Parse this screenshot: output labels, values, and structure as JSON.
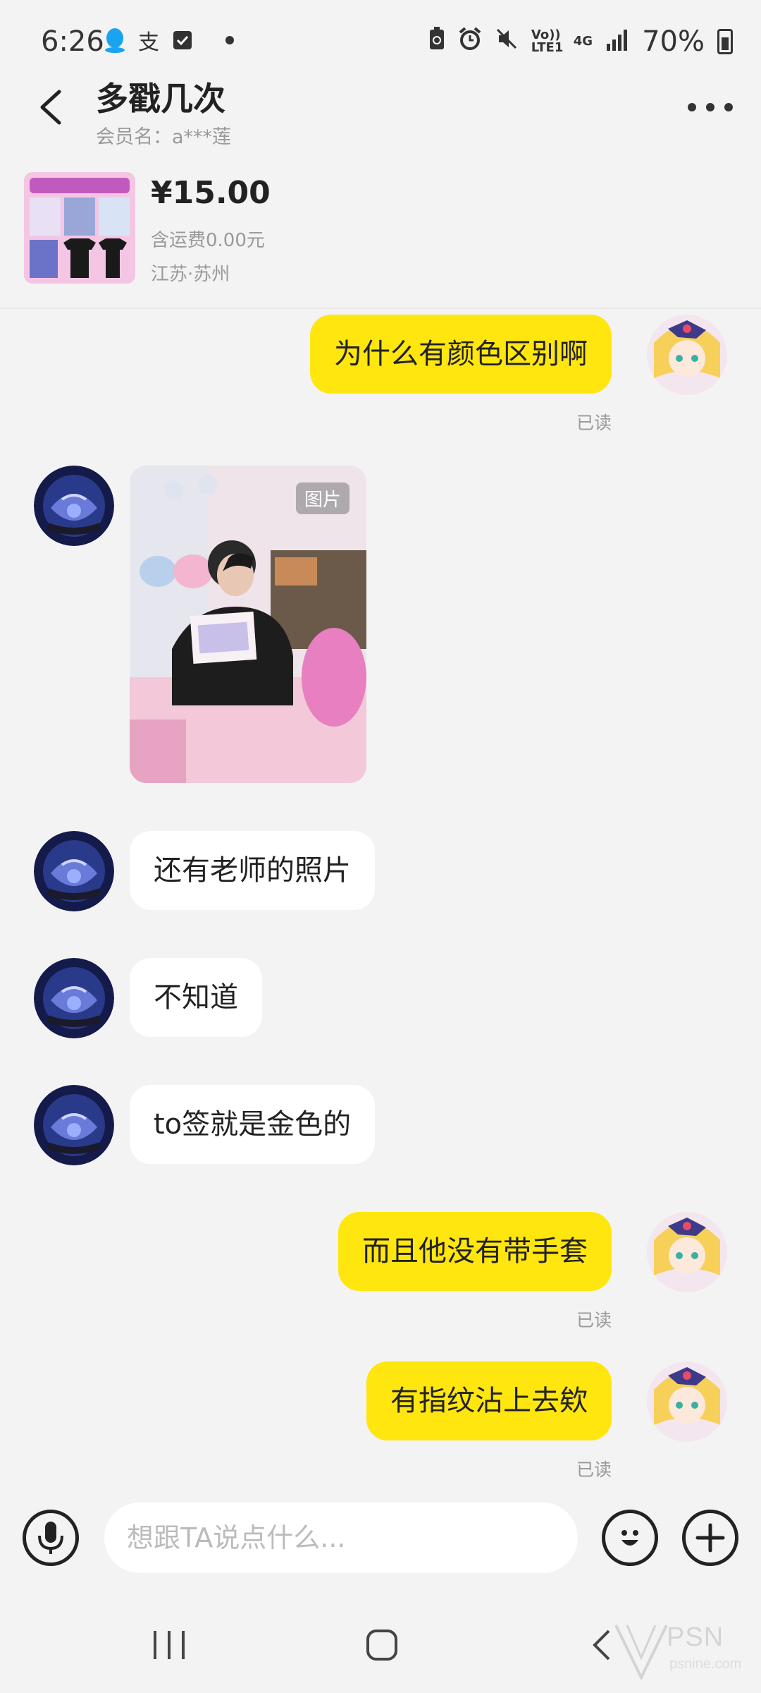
{
  "status_bar": {
    "time": "6:26",
    "app_icon_label": "支",
    "volte_label": "Vo)) LTE1",
    "network_label": "4G",
    "battery_text": "70%"
  },
  "header": {
    "title": "多戳几次",
    "member_label": "会员名：",
    "member_name": "a***莲"
  },
  "product": {
    "price": "¥15.00",
    "shipping": "含运费0.00元",
    "location": "江苏·苏州"
  },
  "messages": [
    {
      "side": "me",
      "text": "为什么有颜色区别啊",
      "status": "已读"
    },
    {
      "side": "them",
      "type": "image",
      "tag": "图片"
    },
    {
      "side": "them",
      "text": "还有老师的照片"
    },
    {
      "side": "them",
      "text": "不知道"
    },
    {
      "side": "them",
      "text": "to签就是金色的"
    },
    {
      "side": "me",
      "text": "而且他没有带手套",
      "status": "已读"
    },
    {
      "side": "me",
      "text": "有指纹沾上去欸",
      "status": "已读"
    }
  ],
  "input": {
    "placeholder": "想跟TA说点什么..."
  },
  "watermark": {
    "text": "PSN",
    "sub": "psnine.com"
  },
  "colors": {
    "my_bubble": "#ffe60f",
    "their_bubble": "#ffffff",
    "background": "#f3f3f3"
  }
}
